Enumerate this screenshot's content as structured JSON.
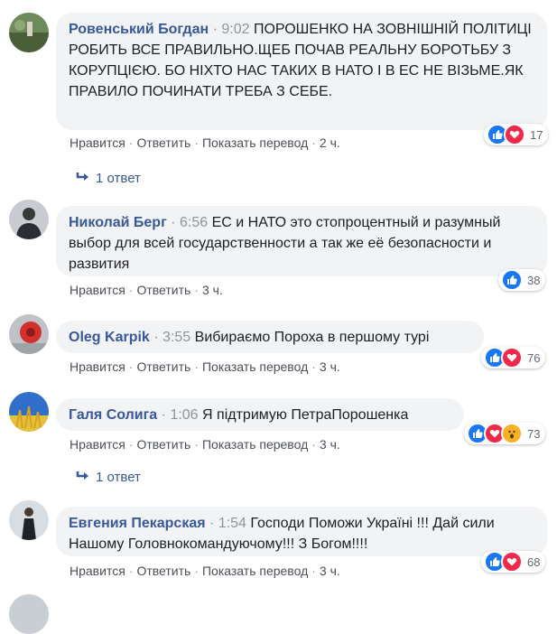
{
  "comments": [
    {
      "author": "Ровенський Богдан",
      "time": "9:02",
      "text": "ПОРОШЕНКО НА ЗОВНІШНІЙ ПОЛІТИЦІ РОБИТЬ ВСЕ ПРАВИЛЬНО.ЩЕБ ПОЧАВ РЕАЛЬНУ БОРОТЬБУ З КОРУПЦІЄЮ. БО НІХТО НАС ТАКИХ В НАТО І В ЕС НЕ ВІЗЬМЕ.ЯК ПРАВИЛО ПОЧИНАТИ ТРЕБА З СЕБЕ.",
      "like_label": "Нравится",
      "reply_label": "Ответить",
      "translate_label": "Показать перевод",
      "age": "2 ч.",
      "reactions": [
        "like-icon",
        "love-icon"
      ],
      "reaction_count": "17",
      "replies": "1 ответ"
    },
    {
      "author": "Николай Берг",
      "time": "6:56",
      "text": "ЕС и НАТО это стопроцентный и разумный выбор для всей государственности а так же её безопасности и развития",
      "like_label": "Нравится",
      "reply_label": "Ответить",
      "age": "3 ч.",
      "reactions": [
        "like-icon"
      ],
      "reaction_count": "38"
    },
    {
      "author": "Oleg Karpik",
      "time": "3:55",
      "text": "Вибираємо Пороха в першому турі",
      "like_label": "Нравится",
      "reply_label": "Ответить",
      "translate_label": "Показать перевод",
      "age": "3 ч.",
      "reactions": [
        "like-icon",
        "love-icon"
      ],
      "reaction_count": "76"
    },
    {
      "author": "Галя Солига",
      "time": "1:06",
      "text": "Я підтримую ПетраПорошенка",
      "like_label": "Нравится",
      "reply_label": "Ответить",
      "translate_label": "Показать перевод",
      "age": "3 ч.",
      "reactions": [
        "like-icon",
        "love-icon",
        "wow-icon"
      ],
      "reaction_count": "73",
      "replies": "1 ответ"
    },
    {
      "author": "Евгения Пекарская",
      "time": "1:54",
      "text": "Господи Поможи Україні !!! Дай сили Нашому Головнокомандуючому!!! З Богом!!!!",
      "like_label": "Нравится",
      "reply_label": "Ответить",
      "translate_label": "Показать перевод",
      "age": "3 ч.",
      "reactions": [
        "like-icon",
        "love-icon"
      ],
      "reaction_count": "68"
    }
  ],
  "separator": "·",
  "colors": {
    "author": "#385898",
    "bubble": "#f2f3f5",
    "like": "#1877f2",
    "love": "#f0284a",
    "wow": "#f7b125"
  }
}
